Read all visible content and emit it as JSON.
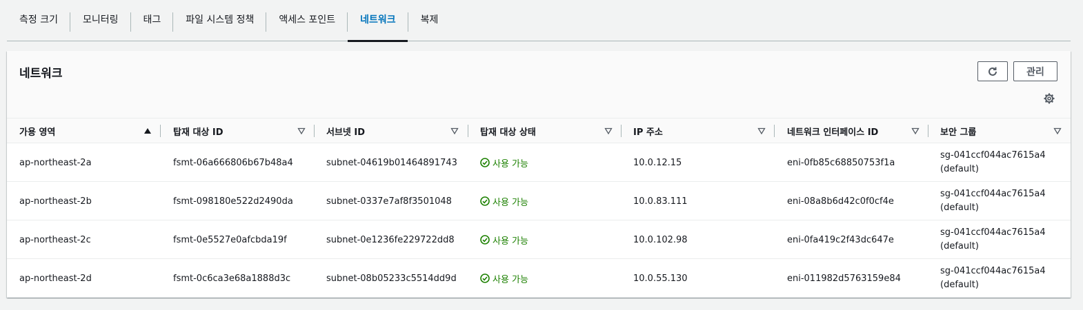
{
  "tabs": [
    {
      "label": "측정 크기"
    },
    {
      "label": "모니터링"
    },
    {
      "label": "태그"
    },
    {
      "label": "파일 시스템 정책"
    },
    {
      "label": "액세스 포인트"
    },
    {
      "label": "네트워크",
      "active": true
    },
    {
      "label": "복제"
    }
  ],
  "panel": {
    "title": "네트워크",
    "manage_label": "관리"
  },
  "columns": [
    {
      "label": "가용 영역",
      "sort": "ascending"
    },
    {
      "label": "탑재 대상 ID",
      "sort": "none"
    },
    {
      "label": "서브넷 ID",
      "sort": "none"
    },
    {
      "label": "탑재 대상 상태",
      "sort": "none"
    },
    {
      "label": "IP 주소",
      "sort": "none"
    },
    {
      "label": "네트워크 인터페이스 ID",
      "sort": "none"
    },
    {
      "label": "보안 그룹",
      "sort": "none"
    }
  ],
  "rows": [
    {
      "az": "ap-northeast-2a",
      "mount_id": "fsmt-06a666806b67b48a4",
      "subnet": "subnet-04619b01464891743",
      "status": "사용 가능",
      "ip": "10.0.12.15",
      "eni": "eni-0fb85c68850753f1a",
      "sg": "sg-041ccf044ac7615a4",
      "sg_name": "(default)"
    },
    {
      "az": "ap-northeast-2b",
      "mount_id": "fsmt-098180e522d2490da",
      "subnet": "subnet-0337e7af8f3501048",
      "status": "사용 가능",
      "ip": "10.0.83.111",
      "eni": "eni-08a8b6d42c0f0cf4e",
      "sg": "sg-041ccf044ac7615a4",
      "sg_name": "(default)"
    },
    {
      "az": "ap-northeast-2c",
      "mount_id": "fsmt-0e5527e0afcbda19f",
      "subnet": "subnet-0e1236fe229722dd8",
      "status": "사용 가능",
      "ip": "10.0.102.98",
      "eni": "eni-0fa419c2f43dc647e",
      "sg": "sg-041ccf044ac7615a4",
      "sg_name": "(default)"
    },
    {
      "az": "ap-northeast-2d",
      "mount_id": "fsmt-0c6ca3e68a1888d3c",
      "subnet": "subnet-08b05233c5514dd9d",
      "status": "사용 가능",
      "ip": "10.0.55.130",
      "eni": "eni-011982d5763159e84",
      "sg": "sg-041ccf044ac7615a4",
      "sg_name": "(default)"
    }
  ],
  "colors": {
    "active_tab": "#0073bb",
    "status_available": "#1d8102",
    "background": "#f2f3f3"
  },
  "icons": {
    "refresh": "refresh-icon",
    "settings": "gear-icon",
    "status": "check-circle-icon",
    "sort_asc": "sort-ascending-icon",
    "sort_none": "sort-icon"
  }
}
